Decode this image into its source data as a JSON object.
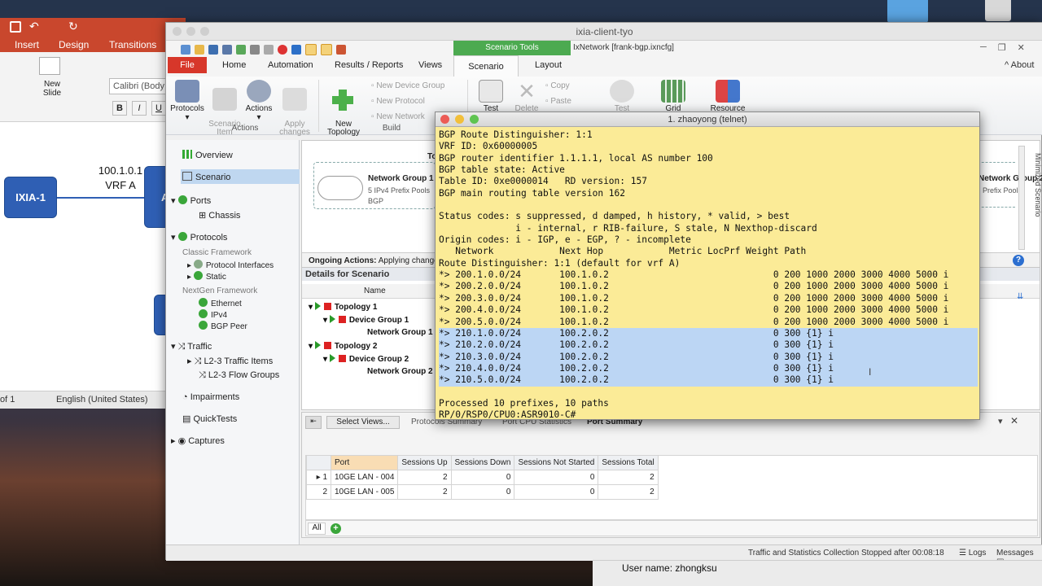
{
  "ppt": {
    "tabs": [
      "Insert",
      "Design",
      "Transitions"
    ],
    "font_name": "Calibri (Body",
    "new_slide": "New\nSlide",
    "link_label": "100.1.0.1",
    "vrf_label": "VRF A",
    "device_label": "IXIA-1",
    "device_label_2": "A",
    "status_page": "of 1",
    "status_lang": "English (United States)"
  },
  "window": {
    "title": "ixia-client-tyo",
    "file_title": "IxNetwork [frank-bgp.ixncfg]",
    "about": "About",
    "scenario_tools": "Scenario Tools",
    "tabs": [
      "File",
      "Home",
      "Automation",
      "Results / Reports",
      "Views",
      "Scenario",
      "Layout"
    ]
  },
  "ribbon": {
    "protocols": "Protocols",
    "scenario_item": "Scenario\nItem",
    "actions": "Actions",
    "apply_changes": "Apply\nchanges",
    "actions_group": "Actions",
    "new_topology": "New\nTopology",
    "new_device_group": "New Device Group",
    "new_protocol": "New Protocol",
    "new_network": "New Network",
    "build_group": "Build",
    "test": "Test",
    "delete": "Delete",
    "copy": "Copy",
    "paste": "Paste",
    "test2": "Test",
    "grid": "Grid",
    "resource": "Resource"
  },
  "nav": {
    "overview": "Overview",
    "scenario": "Scenario",
    "ports": "Ports",
    "chassis": "Chassis",
    "protocols": "Protocols",
    "classic": "Classic Framework",
    "protocol_interfaces": "Protocol Interfaces",
    "static": "Static",
    "nextgen": "NextGen Framework",
    "ethernet": "Ethernet",
    "ipv4": "IPv4",
    "bgp_peer": "BGP Peer",
    "traffic": "Traffic",
    "l23_items": "L2-3 Traffic Items",
    "l23_flows": "L2-3 Flow Groups",
    "impairments": "Impairments",
    "quicktests": "QuickTests",
    "captures": "Captures"
  },
  "scenario": {
    "topology_stub": "To",
    "network_group_1": "Network Group 1",
    "pools_1": "5 IPv4 Prefix Pools",
    "bgp": "BGP",
    "network_group_2": "Network Group 2",
    "pools_2": "Prefix Pools",
    "ongoing_label": "Ongoing Actions:",
    "ongoing_value": "Applying change",
    "minimized": "Minimized Scenario"
  },
  "details": {
    "title": "Details for Scenario",
    "name_header": "Name",
    "rows": [
      "Topology 1",
      "Device Group 1",
      "Network Group 1",
      "Topology 2",
      "Device Group 2",
      "Network Group 2"
    ]
  },
  "bottom": {
    "select_views": "Select Views...",
    "tabs": [
      "Protocols Summary",
      "Port CPU Statistics",
      "Port Summary"
    ],
    "headers": [
      "Port",
      "Sessions Up",
      "Sessions Down",
      "Sessions Not Started",
      "Sessions Total"
    ],
    "rows": [
      {
        "n": "1",
        "port": "10GE LAN - 004",
        "up": "2",
        "down": "0",
        "ns": "0",
        "total": "2"
      },
      {
        "n": "2",
        "port": "10GE LAN - 005",
        "up": "2",
        "down": "0",
        "ns": "0",
        "total": "2"
      }
    ],
    "all": "All"
  },
  "status": {
    "message": "Traffic and Statistics Collection Stopped after 00:08:18",
    "logs": "Logs",
    "messages": "Messages"
  },
  "terminal": {
    "title": "1. zhaoyong (telnet)",
    "lines": [
      "BGP Route Distinguisher: 1:1",
      "VRF ID: 0x60000005",
      "BGP router identifier 1.1.1.1, local AS number 100",
      "BGP table state: Active",
      "Table ID: 0xe0000014   RD version: 157",
      "BGP main routing table version 162",
      "",
      "Status codes: s suppressed, d damped, h history, * valid, > best",
      "              i - internal, r RIB-failure, S stale, N Nexthop-discard",
      "Origin codes: i - IGP, e - EGP, ? - incomplete",
      "   Network            Next Hop            Metric LocPrf Weight Path",
      "Route Distinguisher: 1:1 (default for vrf A)",
      "*> 200.1.0.0/24       100.1.0.2                              0 200 1000 2000 3000 4000 5000 i",
      "*> 200.2.0.0/24       100.1.0.2                              0 200 1000 2000 3000 4000 5000 i",
      "*> 200.3.0.0/24       100.1.0.2                              0 200 1000 2000 3000 4000 5000 i",
      "*> 200.4.0.0/24       100.1.0.2                              0 200 1000 2000 3000 4000 5000 i",
      "*> 200.5.0.0/24       100.1.0.2                              0 200 1000 2000 3000 4000 5000 i",
      "*> 210.1.0.0/24       100.2.0.2                              0 300 {1} i",
      "*> 210.2.0.0/24       100.2.0.2                              0 300 {1} i",
      "*> 210.3.0.0/24       100.2.0.2                              0 300 {1} i",
      "*> 210.4.0.0/24       100.2.0.2                              0 300 {1} i",
      "*> 210.5.0.0/24       100.2.0.2                              0 300 {1} i",
      "",
      "Processed 10 prefixes, 10 paths",
      "RP/0/RSP0/CPU0:ASR9010-C#"
    ]
  },
  "user_box": "User name: zhongksu"
}
